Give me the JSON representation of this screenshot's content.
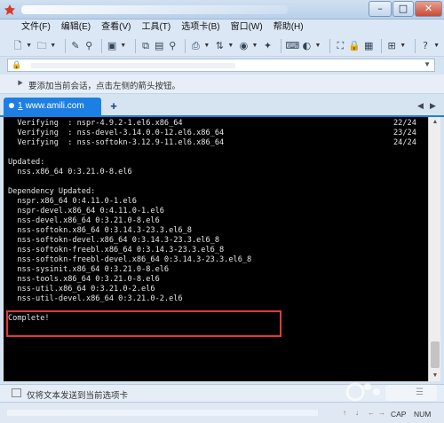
{
  "menubar": {
    "items": [
      "文件(F)",
      "编辑(E)",
      "查看(V)",
      "工具(T)",
      "选项卡(B)",
      "窗口(W)",
      "帮助(H)"
    ]
  },
  "session": {
    "hint": "要添加当前会话，点击左侧的箭头按钮。"
  },
  "tab": {
    "number": "1",
    "label": "www.amili.com",
    "new_tab": "+"
  },
  "terminal": {
    "lines": [
      {
        "text": "  Verifying  : nspr-4.9.2-1.el6.x86_64",
        "right": "22/24"
      },
      {
        "text": "  Verifying  : nss-devel-3.14.0.0-12.el6.x86_64",
        "right": "23/24"
      },
      {
        "text": "  Verifying  : nss-softokn-3.12.9-11.el6.x86_64",
        "right": "24/24"
      },
      {
        "text": "",
        "right": ""
      },
      {
        "text": "Updated:",
        "right": ""
      },
      {
        "text": "  nss.x86_64 0:3.21.0-8.el6",
        "right": ""
      },
      {
        "text": "",
        "right": ""
      },
      {
        "text": "Dependency Updated:",
        "right": ""
      },
      {
        "text": "  nspr.x86_64 0:4.11.0-1.el6",
        "right": ""
      },
      {
        "text": "  nspr-devel.x86_64 0:4.11.0-1.el6",
        "right": ""
      },
      {
        "text": "  nss-devel.x86_64 0:3.21.0-8.el6",
        "right": ""
      },
      {
        "text": "  nss-softokn.x86_64 0:3.14.3-23.3.el6_8",
        "right": ""
      },
      {
        "text": "  nss-softokn-devel.x86_64 0:3.14.3-23.3.el6_8",
        "right": ""
      },
      {
        "text": "  nss-softokn-freebl.x86_64 0:3.14.3-23.3.el6_8",
        "right": ""
      },
      {
        "text": "  nss-softokn-freebl-devel.x86_64 0:3.14.3-23.3.el6_8",
        "right": ""
      },
      {
        "text": "  nss-sysinit.x86_64 0:3.21.0-8.el6",
        "right": ""
      },
      {
        "text": "  nss-tools.x86_64 0:3.21.0-8.el6",
        "right": ""
      },
      {
        "text": "  nss-util.x86_64 0:3.21.0-2.el6",
        "right": ""
      },
      {
        "text": "  nss-util-devel.x86_64 0:3.21.0-2.el6",
        "right": ""
      },
      {
        "text": "",
        "right": ""
      },
      {
        "text": "Complete!",
        "right": ""
      }
    ]
  },
  "sendbar": {
    "label": "仅将文本发送到当前选项卡"
  },
  "status": {
    "caps": "CAP",
    "num": "NUM"
  },
  "colors": {
    "tab_accent": "#1d7fe3",
    "highlight": "#e03a3a",
    "terminal_bg": "#000000",
    "terminal_fg": "#e6e6e6"
  }
}
